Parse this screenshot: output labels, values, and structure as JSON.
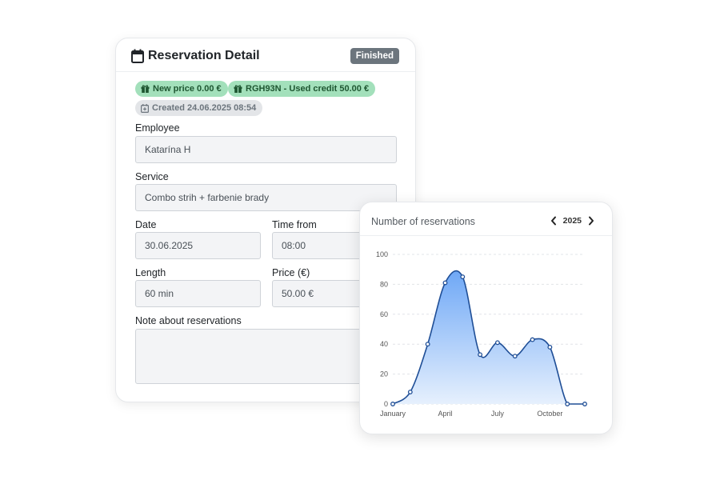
{
  "reservation": {
    "title": "Reservation Detail",
    "status": "Finished",
    "tags": [
      {
        "text": "New price 0.00 €",
        "icon": "gift-icon"
      },
      {
        "text": "RGH93N - Used credit 50.00 €",
        "icon": "gift-icon"
      },
      {
        "text": "Created 24.06.2025 08:54",
        "icon": "calendar-plus-icon"
      }
    ],
    "fields": {
      "employee": {
        "label": "Employee",
        "value": "Katarína H"
      },
      "service": {
        "label": "Service",
        "value": "Combo strih + farbenie brady"
      },
      "date": {
        "label": "Date",
        "value": "30.06.2025"
      },
      "time_from": {
        "label": "Time from",
        "value": "08:00"
      },
      "length": {
        "label": "Length",
        "value": "60 min"
      },
      "price": {
        "label": "Price (€)",
        "value": "50.00 €"
      },
      "note": {
        "label": "Note about reservations",
        "value": ""
      }
    }
  },
  "chart_card": {
    "title": "Number of reservations",
    "year": "2025",
    "prev_icon": "chevron-left-icon",
    "next_icon": "chevron-right-icon"
  },
  "chart_data": {
    "type": "area",
    "x": [
      "January",
      "February",
      "March",
      "April",
      "May",
      "June",
      "July",
      "August",
      "September",
      "October",
      "November",
      "December"
    ],
    "x_tick_labels": [
      "January",
      "April",
      "July",
      "October"
    ],
    "values": [
      0,
      8,
      40,
      81,
      85,
      33,
      41,
      32,
      43,
      38,
      0,
      0
    ],
    "ylim": [
      0,
      100
    ],
    "y_ticks": [
      0,
      20,
      40,
      60,
      80,
      100
    ],
    "grid": true,
    "colors": {
      "line": "#1f4e96",
      "fill_top": "#6fa8f6",
      "fill_bottom": "#e6f0fd",
      "grid": "#e1e4e8"
    }
  },
  "colors": {
    "status_badge": "#6c757d",
    "green_pill": "#a3e0bb",
    "grey_pill": "#e3e5e8",
    "input_bg": "#f3f4f6"
  }
}
